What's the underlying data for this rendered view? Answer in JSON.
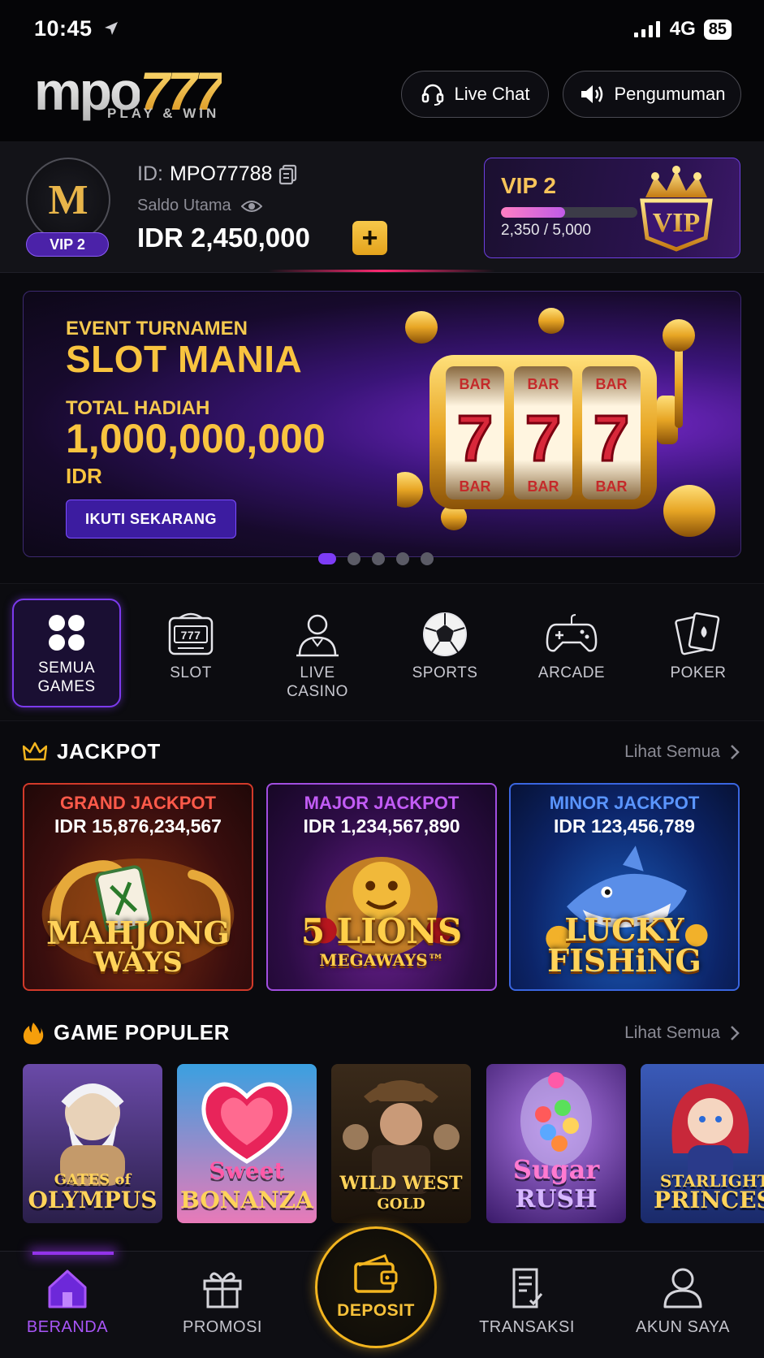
{
  "status_bar": {
    "time": "10:45",
    "network": "4G",
    "battery": "85"
  },
  "header": {
    "logo_main": "mpo",
    "logo_num": "777",
    "logo_tagline": "PLAY & WIN",
    "live_chat": "Live Chat",
    "announcement": "Pengumuman"
  },
  "account": {
    "avatar_letter": "M",
    "avatar_vip": "VIP 2",
    "id_label": "ID:",
    "id_value": "MPO77788",
    "saldo_label": "Saldo Utama",
    "balance": "IDR 2,450,000",
    "plus": "+",
    "vip_title": "VIP 2",
    "vip_progress_text": "2,350 / 5,000",
    "vip_progress_fraction": 0.47,
    "vip_badge_text": "VIP"
  },
  "banner": {
    "event": "EVENT TURNAMEN",
    "title": "SLOT MANIA",
    "total_label": "TOTAL HADIAH",
    "amount": "1,000,000,000",
    "currency": "IDR",
    "cta": "IKUTI SEKARANG",
    "reel_top": "BAR",
    "reel_mid": "7",
    "slides": 5,
    "active_slide": 1
  },
  "categories": [
    {
      "line1": "SEMUA",
      "line2": "GAMES",
      "icon": "grid-icon"
    },
    {
      "line1": "SLOT",
      "line2": "",
      "icon": "slot-machine-icon"
    },
    {
      "line1": "LIVE",
      "line2": "CASINO",
      "icon": "dealer-icon"
    },
    {
      "line1": "SPORTS",
      "line2": "",
      "icon": "soccer-ball-icon"
    },
    {
      "line1": "ARCADE",
      "line2": "",
      "icon": "gamepad-icon"
    },
    {
      "line1": "POKER",
      "line2": "",
      "icon": "cards-icon"
    }
  ],
  "jackpot": {
    "title": "JACKPOT",
    "see_all": "Lihat Semua",
    "items": [
      {
        "name": "GRAND JACKPOT",
        "currency": "IDR",
        "amount": "15,876,234,567",
        "game_line1": "MAHJONG",
        "game_line2": "WAYS",
        "name_color": "#ff5a4a"
      },
      {
        "name": "MAJOR JACKPOT",
        "currency": "IDR",
        "amount": "1,234,567,890",
        "game_line1": "5 LIONS",
        "game_line2": "MEGAWAYS™",
        "name_color": "#c25cf5"
      },
      {
        "name": "MINOR JACKPOT",
        "currency": "IDR",
        "amount": "123,456,789",
        "game_line1": "LUCKY",
        "game_line2": "FISHiNG",
        "name_color": "#5a95ff"
      }
    ]
  },
  "popular": {
    "title": "GAME POPULER",
    "see_all": "Lihat Semua",
    "games": [
      {
        "line1": "GATES of",
        "line2": "OLYMPUS"
      },
      {
        "line1": "Sweet",
        "line2": "BONANZA"
      },
      {
        "line1": "WILD WEST",
        "line2": "GOLD"
      },
      {
        "line1": "Sugar",
        "line2": "RUSH"
      },
      {
        "line1": "STARLIGHT",
        "line2": "PRINCESS"
      }
    ]
  },
  "nav": {
    "home": "BERANDA",
    "promo": "PROMOSI",
    "deposit": "DEPOSIT",
    "transaksi": "TRANSAKSI",
    "akun": "AKUN SAYA"
  },
  "colors": {
    "accent_purple": "#7c3aed",
    "gold": "#f7c23a"
  }
}
